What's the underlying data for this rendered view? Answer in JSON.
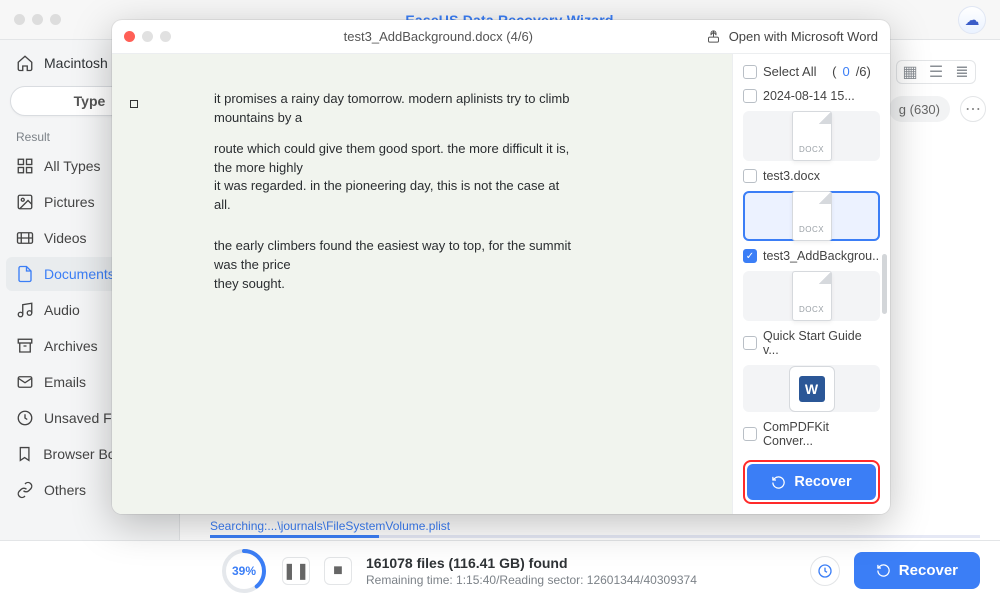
{
  "app_title": "EaseUS Data Recovery Wizard",
  "breadcrumb": "Macintosh",
  "type_label": "Type",
  "result_label": "Result",
  "sidebar": {
    "items": [
      {
        "label": "All Types"
      },
      {
        "label": "Pictures"
      },
      {
        "label": "Videos"
      },
      {
        "label": "Documents",
        "active": true
      },
      {
        "label": "Audio"
      },
      {
        "label": "Archives"
      },
      {
        "label": "Emails"
      },
      {
        "label": "Unsaved Files"
      },
      {
        "label": "Browser Bookmarks"
      },
      {
        "label": "Others"
      }
    ]
  },
  "filter_chip": "g (630)",
  "status": {
    "searching": "Searching:...\\journals\\FileSystemVolume.plist",
    "progress_pct": "39%",
    "found_line": "161078 files (116.41 GB) found",
    "remaining": "Remaining time: 1:15:40/Reading sector: 12601344/40309374",
    "recover_label": "Recover"
  },
  "modal": {
    "title": "test3_AddBackground.docx (4/6)",
    "open_with": "Open with Microsoft Word",
    "select_all_label": "Select All",
    "select_all_count_sel": "0",
    "select_all_count_total": "/6)",
    "select_all_paren_open": "(",
    "recover_label": "Recover",
    "preview": {
      "p1": "it promises a rainy day tomorrow. modern aplinists try to climb mountains by a",
      "p2": "route which could give them good sport. the more difficult it is, the more highly",
      "p3": "it was regarded. in the pioneering day, this is not the case at all.",
      "p4": "the early climbers found the easiest way to top, for the summit was the price",
      "p5": "they sought."
    },
    "files": [
      {
        "name": "2024-08-14 15...",
        "thumb": "none"
      },
      {
        "name": "test3.docx",
        "thumb": "docx"
      },
      {
        "name": "test3_AddBackgrou...",
        "thumb": "docx",
        "selected": true,
        "checked": true
      },
      {
        "name": "Quick Start Guide v...",
        "thumb": "docx"
      },
      {
        "name": "ComPDFKit Conver...",
        "thumb": "word"
      }
    ]
  }
}
